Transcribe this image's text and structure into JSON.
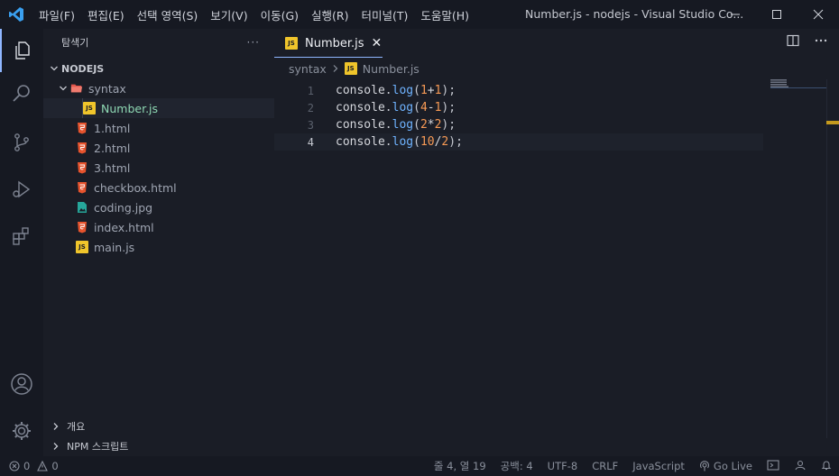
{
  "titlebar": {
    "menu": [
      "파일(F)",
      "편집(E)",
      "선택 영역(S)",
      "보기(V)",
      "이동(G)",
      "실행(R)",
      "터미널(T)",
      "도움말(H)"
    ],
    "window_title": "Number.js - nodejs - Visual Studio Co..."
  },
  "sidebar": {
    "header": "탐색기",
    "header_more": "···",
    "root": "NODEJS",
    "folder": "syntax",
    "files_in_folder": [
      {
        "name": "Number.js",
        "icon": "js-file-icon"
      }
    ],
    "files": [
      {
        "name": "1.html",
        "icon": "html-file-icon"
      },
      {
        "name": "2.html",
        "icon": "html-file-icon"
      },
      {
        "name": "3.html",
        "icon": "html-file-icon"
      },
      {
        "name": "checkbox.html",
        "icon": "html-file-icon"
      },
      {
        "name": "coding.jpg",
        "icon": "image-file-icon"
      },
      {
        "name": "index.html",
        "icon": "html-file-icon"
      },
      {
        "name": "main.js",
        "icon": "js-file-icon"
      }
    ],
    "outline_label": "개요",
    "npm_label": "NPM 스크립트"
  },
  "editor": {
    "tab_label": "Number.js",
    "tab_close": "✕",
    "breadcrumb": [
      "syntax",
      "Number.js"
    ],
    "lines": [
      {
        "num": "1",
        "obj": "console",
        "fn": "log",
        "a": "1",
        "op": "+",
        "b": "1"
      },
      {
        "num": "2",
        "obj": "console",
        "fn": "log",
        "a": "4",
        "op": "-",
        "b": "1"
      },
      {
        "num": "3",
        "obj": "console",
        "fn": "log",
        "a": "2",
        "op": "*",
        "b": "2"
      },
      {
        "num": "4",
        "obj": "console",
        "fn": "log",
        "a": "10",
        "op": "/",
        "b": "2"
      }
    ]
  },
  "statusbar": {
    "errors": "0",
    "warnings": "0",
    "position": "줄 4, 열 19",
    "spaces": "공백: 4",
    "encoding": "UTF-8",
    "eol": "CRLF",
    "language": "JavaScript",
    "golive": "Go Live"
  },
  "colors": {
    "accent": "#8fb6ff",
    "js_icon": "#f0c52b",
    "html_icon": "#e5532d",
    "number": "#f79a55",
    "function": "#6fb3ff"
  }
}
